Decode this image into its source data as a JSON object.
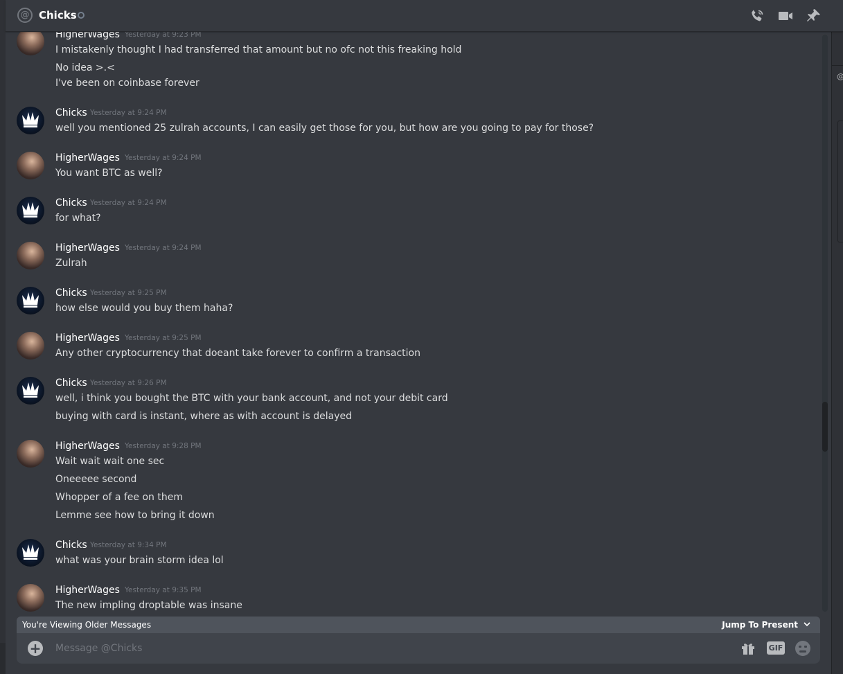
{
  "header": {
    "title": "Chicks",
    "icons": [
      "at-sign-icon",
      "status-indicator-icon",
      "voice-call-icon",
      "video-call-icon",
      "pin-icon"
    ]
  },
  "messages": [
    {
      "author": "HigherWages",
      "timestamp": "Yesterday at 9:23 PM",
      "lines": [
        "I mistakenly thought I had transferred that amount but no ofc not this freaking hold",
        "No idea >.<",
        "I've been on coinbase forever"
      ]
    },
    {
      "author": "Chicks",
      "timestamp": "Yesterday at 9:24 PM",
      "lines": [
        "well you mentioned 25 zulrah accounts, I can easily get those for you, but how are you going to pay for those?"
      ]
    },
    {
      "author": "HigherWages",
      "timestamp": "Yesterday at 9:24 PM",
      "lines": [
        "You want BTC as well?"
      ]
    },
    {
      "author": "Chicks",
      "timestamp": "Yesterday at 9:24 PM",
      "lines": [
        "for what?"
      ]
    },
    {
      "author": "HigherWages",
      "timestamp": "Yesterday at 9:24 PM",
      "lines": [
        "Zulrah"
      ]
    },
    {
      "author": "Chicks",
      "timestamp": "Yesterday at 9:25 PM",
      "lines": [
        "how else would you buy them haha?"
      ]
    },
    {
      "author": "HigherWages",
      "timestamp": "Yesterday at 9:25 PM",
      "lines": [
        "Any other cryptocurrency that doeant take forever to confirm a transaction"
      ]
    },
    {
      "author": "Chicks",
      "timestamp": "Yesterday at 9:26 PM",
      "lines": [
        "well, i think you bought the BTC with your bank account, and not your debit card",
        "buying with card is instant, where as with account is delayed"
      ]
    },
    {
      "author": "HigherWages",
      "timestamp": "Yesterday at 9:28 PM",
      "lines": [
        "Wait wait wait one sec",
        "Oneeeee second",
        "Whopper of a fee on them",
        "Lemme see how to bring it down"
      ]
    },
    {
      "author": "Chicks",
      "timestamp": "Yesterday at 9:34 PM",
      "lines": [
        "what was your brain storm idea lol"
      ]
    },
    {
      "author": "HigherWages",
      "timestamp": "Yesterday at 9:35 PM",
      "lines": [
        "The new impling droptable was insane"
      ]
    }
  ],
  "older_bar": {
    "text": "You're Viewing Older Messages",
    "jump_label": "Jump To Present"
  },
  "composer": {
    "placeholder": "Message @Chicks",
    "gif_label": "GIF"
  },
  "right_panel": {
    "label": "@"
  }
}
